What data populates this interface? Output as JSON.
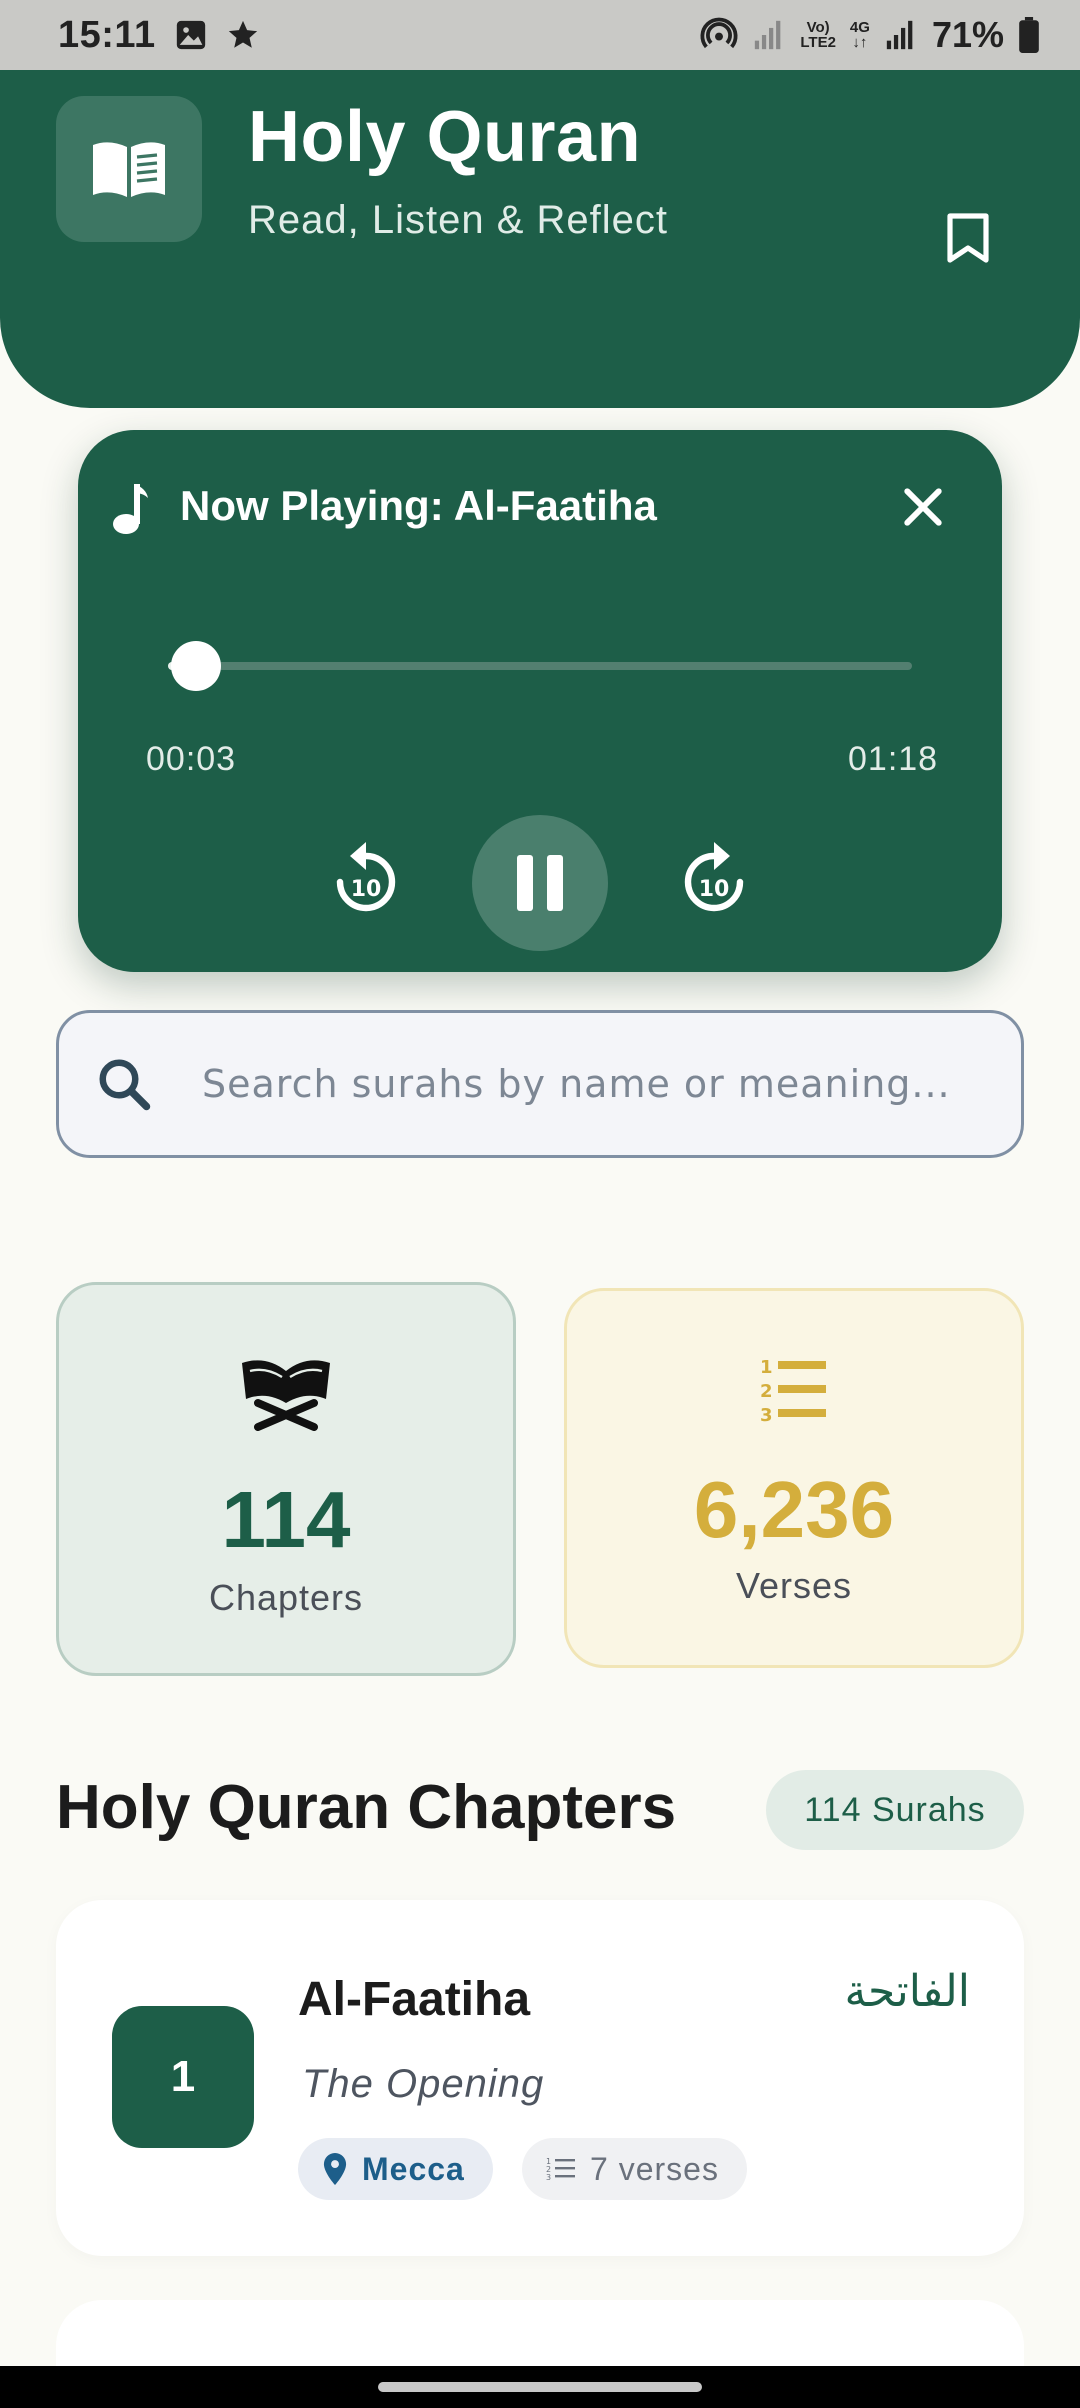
{
  "status_bar": {
    "time": "15:11",
    "network_label_top": "Vo)",
    "network_label_bottom": "LTE2",
    "network_type": "4G",
    "battery": "71%"
  },
  "header": {
    "title": "Holy Quran",
    "subtitle": "Read, Listen & Reflect",
    "logo_icon": "open-book-icon",
    "bookmark_icon": "bookmark-icon"
  },
  "player": {
    "title": "Now Playing: Al-Faatiha",
    "current_time": "00:03",
    "total_time": "01:18",
    "progress": 0.038,
    "rewind_label": "10",
    "forward_label": "10"
  },
  "search": {
    "placeholder": "Search surahs by name or meaning...",
    "value": ""
  },
  "stats": {
    "chapters": {
      "value": "114",
      "label": "Chapters",
      "color": "#1d5e48"
    },
    "verses": {
      "value": "6,236",
      "label": "Verses",
      "color": "#d4ae3c"
    }
  },
  "section": {
    "title": "Holy Quran Chapters",
    "badge": "114 Surahs"
  },
  "surahs": [
    {
      "number": "1",
      "name": "Al-Faatiha",
      "arabic": "الفاتحة",
      "meaning": "The Opening",
      "location": "Mecca",
      "verses": "7 verses"
    }
  ],
  "colors": {
    "primary": "#1d5e48",
    "accent_gold": "#d4ae3c",
    "background": "#fafaf5"
  }
}
